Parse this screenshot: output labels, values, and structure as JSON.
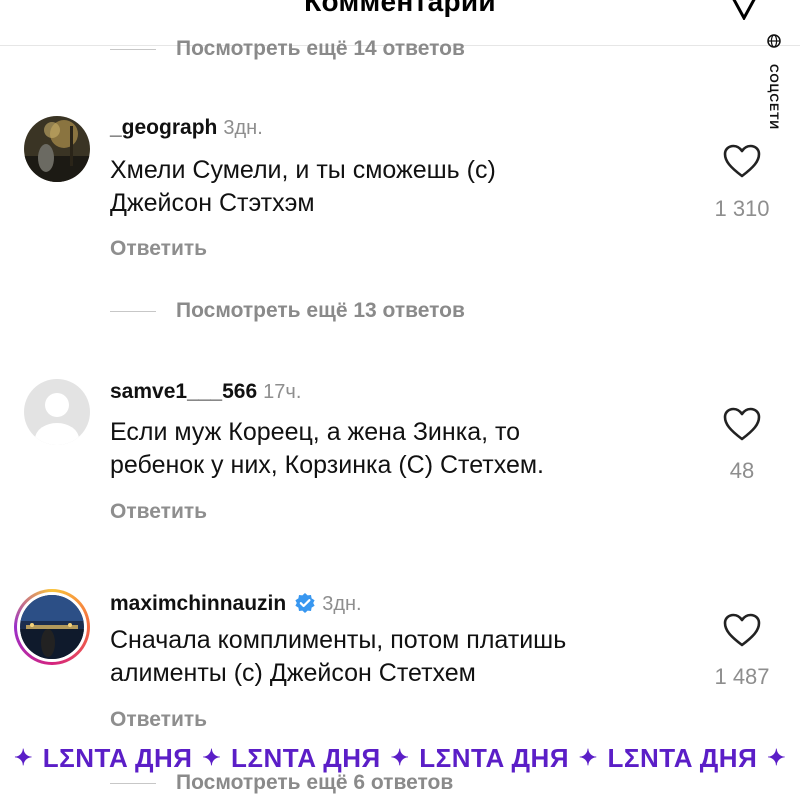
{
  "header": {
    "title": "Комментарии"
  },
  "watermark": {
    "text": "СОЦСЕТИ"
  },
  "top_replies": {
    "label": "Посмотреть ещё 14 ответов"
  },
  "comments": [
    {
      "username": "_geograph",
      "time": "3дн.",
      "verified": false,
      "text": [
        "Хмели Сумели, и ты сможешь (с)",
        "Джейсон Стэтхэм"
      ],
      "reply_label": "Ответить",
      "likes": "1 310",
      "replies_label": "Посмотреть ещё 13 ответов"
    },
    {
      "username": "samve1___566",
      "time": "17ч.",
      "verified": false,
      "text": [
        "Если муж Кореец, а жена Зинка, то",
        "ребенок у них, Корзинка (С) Стетхем."
      ],
      "reply_label": "Ответить",
      "likes": "48"
    },
    {
      "username": "maximchinnauzin",
      "time": "3дн.",
      "verified": true,
      "text": [
        "Сначала комплименты, потом платишь",
        "алименты (с) Джейсон Стетхем"
      ],
      "reply_label": "Ответить",
      "likes": "1 487",
      "replies_label": "Посмотреть ещё 6 ответов"
    }
  ],
  "banner": {
    "text": "LΣNTA ДНЯ",
    "separator": "✦"
  },
  "colors": {
    "brand": "#5b1ec7",
    "muted": "#8e8e8e",
    "verified": "#3897f0"
  }
}
